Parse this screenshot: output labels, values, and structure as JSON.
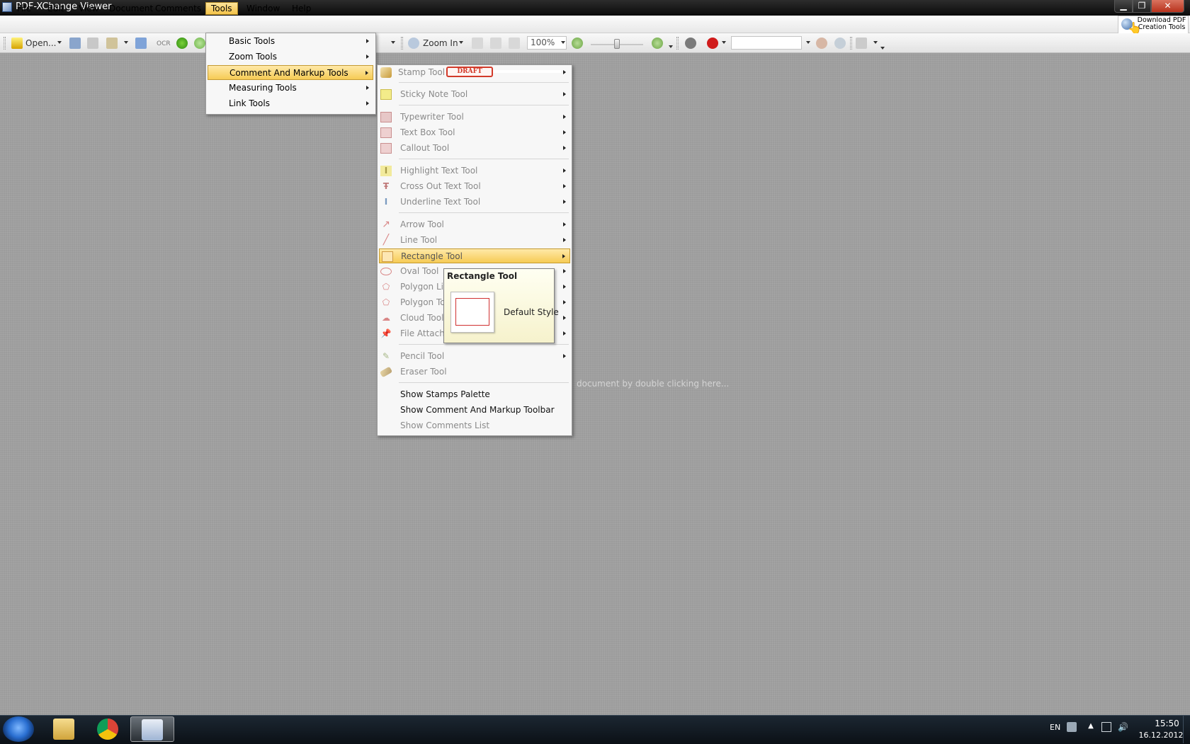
{
  "window": {
    "title": "PDF-XChange Viewer"
  },
  "menubar": [
    "File",
    "Edit",
    "View",
    "Document",
    "Comments",
    "Tools",
    "Window",
    "Help"
  ],
  "download": {
    "line1": "Download PDF",
    "line2": "Creation Tools"
  },
  "toolbar": {
    "open_label": "Open...",
    "zoom_in_label": "Zoom In",
    "zoom_value": "100%",
    "ocr_label": "OCR",
    "search_value": ""
  },
  "tools_menu": {
    "items": [
      "Basic Tools",
      "Zoom Tools",
      "Comment And Markup Tools",
      "Measuring Tools",
      "Link Tools"
    ],
    "active": "Comment And Markup Tools"
  },
  "markup_submenu": {
    "stamp": "Stamp Tool",
    "draft_badge": "DRAFT",
    "sticky": "Sticky Note Tool",
    "typewriter": "Typewriter Tool",
    "textbox": "Text Box Tool",
    "callout": "Callout Tool",
    "highlight": "Highlight Text Tool",
    "crossout": "Cross Out Text Tool",
    "underline": "Underline Text Tool",
    "arrow": "Arrow Tool",
    "line": "Line Tool",
    "rectangle": "Rectangle Tool",
    "oval": "Oval Tool",
    "polygon_line": "Polygon Lin",
    "polygon": "Polygon To",
    "cloud": "Cloud Tool",
    "file_attach": "File Attachm",
    "pencil": "Pencil Tool",
    "eraser": "Eraser Tool",
    "show_stamps": "Show Stamps Palette",
    "show_markup_toolbar": "Show Comment And Markup Toolbar",
    "show_comments_list": "Show Comments List"
  },
  "tooltip": {
    "title": "Rectangle Tool",
    "style": "Default Style"
  },
  "workspace": {
    "hint": "document by double clicking here..."
  },
  "taskbar": {
    "lang": "EN",
    "time": "15:50",
    "date": "16.12.2012"
  },
  "colors": {
    "accent": "#f6cb55",
    "workspace": "#9c9c9c",
    "rect_stroke": "#d03030"
  }
}
